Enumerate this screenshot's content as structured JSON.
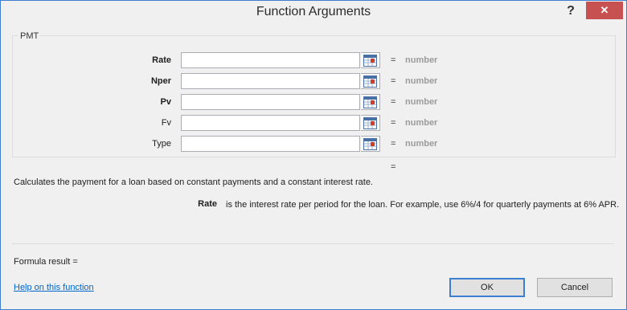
{
  "window": {
    "title": "Function Arguments",
    "help_label": "?",
    "close_label": "✕"
  },
  "function": {
    "name": "PMT",
    "description": "Calculates the payment for a loan based on constant payments and a constant interest rate.",
    "result_eq": "="
  },
  "arguments": [
    {
      "label": "Rate",
      "value": "",
      "eq": "=",
      "type_hint": "number",
      "required": true
    },
    {
      "label": "Nper",
      "value": "",
      "eq": "=",
      "type_hint": "number",
      "required": true
    },
    {
      "label": "Pv",
      "value": "",
      "eq": "=",
      "type_hint": "number",
      "required": true
    },
    {
      "label": "Fv",
      "value": "",
      "eq": "=",
      "type_hint": "number",
      "required": false
    },
    {
      "label": "Type",
      "value": "",
      "eq": "=",
      "type_hint": "number",
      "required": false
    }
  ],
  "arg_help": {
    "name": "Rate",
    "text": "is the interest rate per period for the loan. For example, use 6%/4 for quarterly payments at 6% APR."
  },
  "footer": {
    "formula_result": "Formula result =",
    "help_link": "Help on this function",
    "ok_label": "OK",
    "cancel_label": "Cancel"
  },
  "icons": {
    "ref": "collapse-dialog-icon",
    "help": "help-icon",
    "close": "close-icon"
  },
  "colors": {
    "close_bg": "#c75050",
    "accent": "#3c7fd1",
    "link": "#0066cc",
    "type_hint": "#9b9b9b"
  }
}
